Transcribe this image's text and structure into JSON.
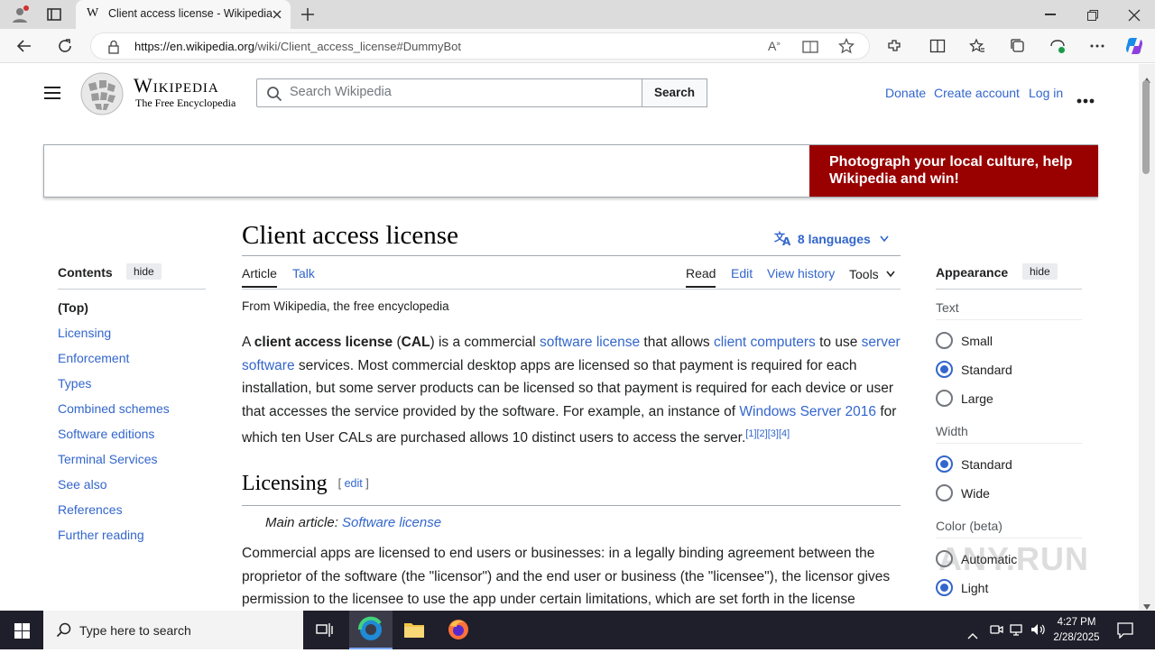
{
  "browser": {
    "tab_title": "Client access license - Wikipedia",
    "tab_favicon": "W",
    "url_host": "https://en.wikipedia.org",
    "url_path": "/wiki/Client_access_license#DummyBot"
  },
  "header": {
    "wordmark": "Wikipedia",
    "tagline": "The Free Encyclopedia",
    "search_placeholder": "Search Wikipedia",
    "search_button": "Search",
    "donate": "Donate",
    "create_account": "Create account",
    "login": "Log in"
  },
  "banner": {
    "text": "Photograph your local culture, help Wikipedia and win!"
  },
  "article": {
    "title": "Client access license",
    "languages": "8 languages",
    "tabs": {
      "article": "Article",
      "talk": "Talk",
      "read": "Read",
      "edit": "Edit",
      "history": "View history",
      "tools": "Tools"
    },
    "from": "From Wikipedia, the free encyclopedia",
    "lead": {
      "p1": "A ",
      "b1": "client access license",
      "p2": " (",
      "b2": "CAL",
      "p3": ") is a commercial ",
      "l1": "software license",
      "p4": " that allows ",
      "l2": "client computers",
      "p5": " to use ",
      "l3": "server software",
      "p6": " services. Most commercial desktop apps are licensed so that payment is required for each installation, but some server products can be licensed so that payment is required for each device or user that accesses the service provided by the software. For example, an instance of ",
      "l4": "Windows Server 2016",
      "p7": " for which ten User CALs are purchased allows 10 distinct users to access the server.",
      "refs": "[1][2][3][4]"
    },
    "section1": {
      "title": "Licensing",
      "edit": "edit"
    },
    "main_article_label": "Main article: ",
    "main_article_link": "Software license",
    "para2": "Commercial apps are licensed to end users or businesses: in a legally binding agreement between the proprietor of the software (the \"licensor\") and the end user or business (the \"licensee\"), the licensor gives permission to the licensee to use the app under certain limitations, which are set forth in the license"
  },
  "toc": {
    "title": "Contents",
    "hide": "hide",
    "items": [
      "(Top)",
      "Licensing",
      "Enforcement",
      "Types",
      "Combined schemes",
      "Software editions",
      "Terminal Services",
      "See also",
      "References",
      "Further reading"
    ]
  },
  "appearance": {
    "title": "Appearance",
    "hide": "hide",
    "text_label": "Text",
    "text_options": [
      "Small",
      "Standard",
      "Large"
    ],
    "width_label": "Width",
    "width_options": [
      "Standard",
      "Wide"
    ],
    "color_label": "Color (beta)",
    "color_options": [
      "Automatic",
      "Light"
    ]
  },
  "taskbar": {
    "search_placeholder": "Type here to search",
    "time": "4:27 PM",
    "date": "2/28/2025"
  },
  "watermark": "ANY.RUN",
  "colors": {
    "link": "#3366cc",
    "banner": "#990000",
    "taskbar": "#1f1f2b"
  }
}
